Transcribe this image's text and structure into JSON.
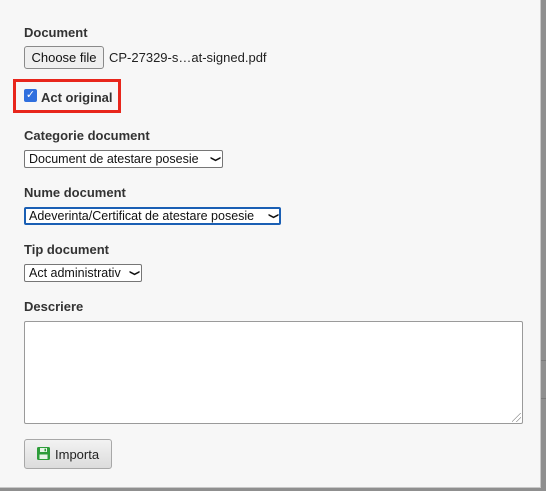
{
  "form": {
    "document_label": "Document",
    "file_button_label": "Choose file",
    "file_name": "CP-27329-s…at-signed.pdf",
    "act_original_label": "Act original",
    "act_original_checked": true,
    "categorie_label": "Categorie document",
    "categorie_value": "Document de atestare posesie",
    "nume_label": "Nume document",
    "nume_value": "Adeverinta/Certificat de atestare posesie",
    "tip_label": "Tip document",
    "tip_value": "Act administrativ",
    "descriere_label": "Descriere",
    "descriere_value": "",
    "import_button_label": "Importa"
  },
  "icons": {
    "dropdown": "chevron-down-icon",
    "save": "floppy-disk-icon",
    "checkbox": "checkmark-icon"
  },
  "colors": {
    "highlight": "#e8261c",
    "checkbox": "#2f6fde",
    "save_icon": "#2e9d3a",
    "focus_border": "#1a5fb4"
  }
}
